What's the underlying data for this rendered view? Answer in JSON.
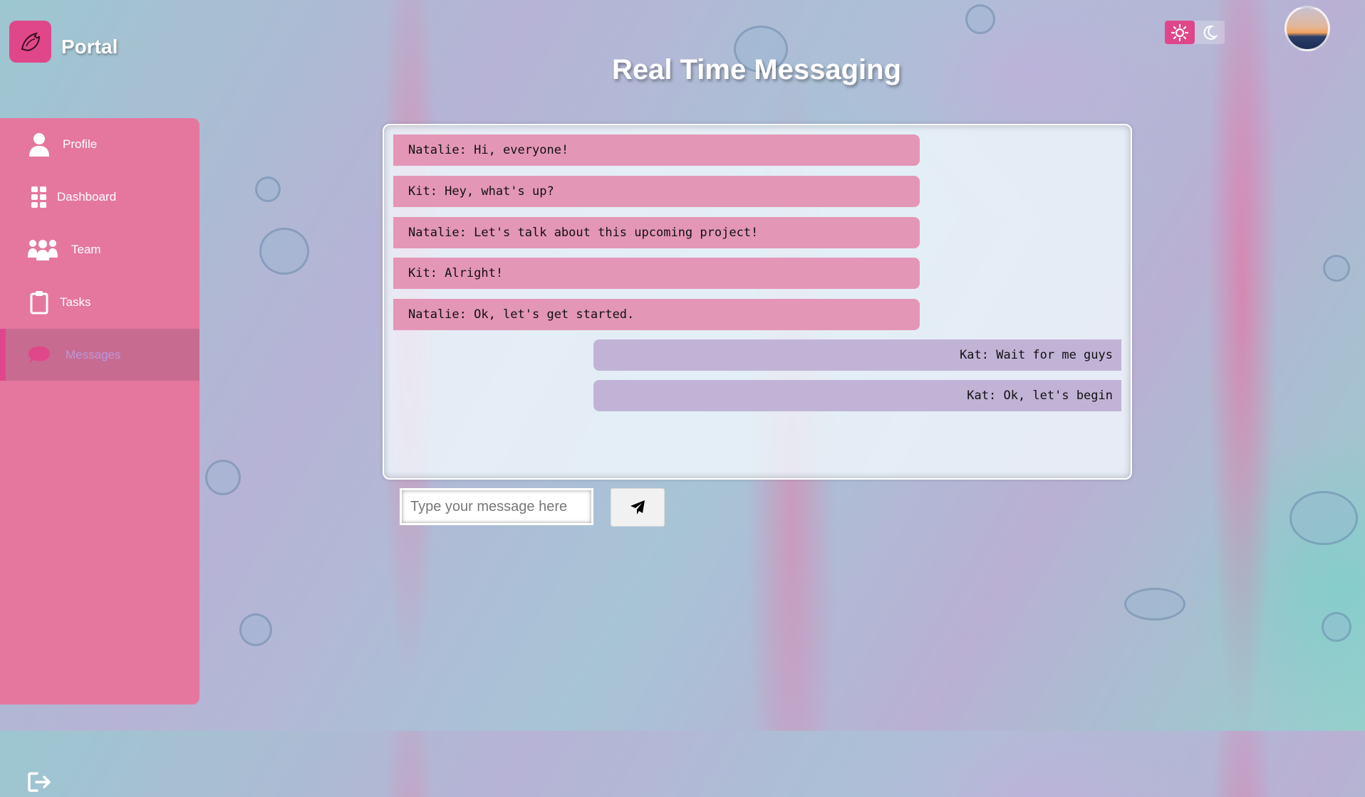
{
  "app": {
    "brand": "Portal",
    "title": "Real Time Messaging"
  },
  "colors": {
    "accent": "#e0478a",
    "sidebar": "#e5779f",
    "incoming": "#e496b6",
    "outgoing": "#c1b3d6"
  },
  "sidebar": {
    "items": [
      {
        "label": "Profile",
        "icon": "user-icon"
      },
      {
        "label": "Dashboard",
        "icon": "grid-icon"
      },
      {
        "label": "Team",
        "icon": "users-icon"
      },
      {
        "label": "Tasks",
        "icon": "clipboard-icon"
      },
      {
        "label": "Messages",
        "icon": "chat-icon",
        "active": true
      }
    ],
    "logout_icon": "logout-icon"
  },
  "theme": {
    "light_icon": "sun-icon",
    "dark_icon": "moon-icon"
  },
  "messages": [
    {
      "text": "Natalie: Hi, everyone!",
      "side": "left"
    },
    {
      "text": "Kit: Hey, what's up?",
      "side": "left"
    },
    {
      "text": "Natalie: Let's talk about this upcoming project!",
      "side": "left"
    },
    {
      "text": "Kit: Alright!",
      "side": "left"
    },
    {
      "text": "Natalie: Ok, let's get started.",
      "side": "left"
    },
    {
      "text": "Kat: Wait for me guys",
      "side": "right"
    },
    {
      "text": "Kat: Ok, let's begin",
      "side": "right"
    }
  ],
  "composer": {
    "placeholder": "Type your message here",
    "send_icon": "send-icon"
  }
}
